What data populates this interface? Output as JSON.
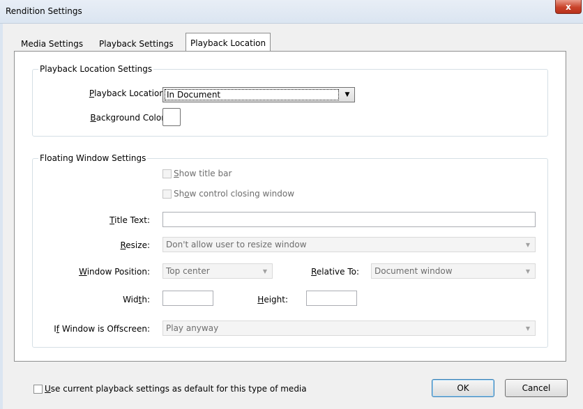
{
  "window": {
    "title": "Rendition Settings",
    "close_glyph": "x"
  },
  "tabs": [
    {
      "label": "Media Settings",
      "active": false
    },
    {
      "label": "Playback Settings",
      "active": false
    },
    {
      "label": "Playback Location",
      "active": true
    }
  ],
  "playback_location_settings": {
    "legend": "Playback Location Settings",
    "playback_location": {
      "label_mnemonic": "P",
      "label_rest": "layback Location:",
      "value": "In Document"
    },
    "background_color": {
      "label_mnemonic": "B",
      "label_rest": "ackground Color:",
      "color": "#ffffff"
    }
  },
  "floating_window_settings": {
    "legend": "Floating Window Settings",
    "show_title_bar": {
      "mnemonic": "S",
      "rest": "how title bar",
      "checked": false,
      "enabled": false
    },
    "show_control": {
      "pre": "Sh",
      "mnemonic": "o",
      "rest": "w control closing window",
      "checked": false,
      "enabled": false
    },
    "title_text": {
      "label_mnemonic": "T",
      "label_rest": "itle Text:",
      "value": ""
    },
    "resize": {
      "label_mnemonic": "R",
      "label_rest": "esize:",
      "value": "Don't allow user to resize window"
    },
    "window_position": {
      "label_mnemonic": "W",
      "label_rest": "indow Position:",
      "value": "Top center"
    },
    "relative_to": {
      "label_mnemonic": "R",
      "label_rest": "elative To:",
      "value": "Document window"
    },
    "width": {
      "label_pre": "Wid",
      "label_mnemonic": "t",
      "label_rest": "h:",
      "value": ""
    },
    "height": {
      "label_mnemonic": "H",
      "label_rest": "eight:",
      "value": ""
    },
    "offscreen": {
      "label_pre": "I",
      "label_mnemonic": "f",
      "label_rest": " Window is Offscreen:",
      "value": "Play anyway"
    }
  },
  "footer": {
    "default_checkbox": {
      "mnemonic": "U",
      "rest": "se current playback settings as default for this type of media",
      "checked": false
    },
    "ok_label": "OK",
    "cancel_label": "Cancel"
  }
}
